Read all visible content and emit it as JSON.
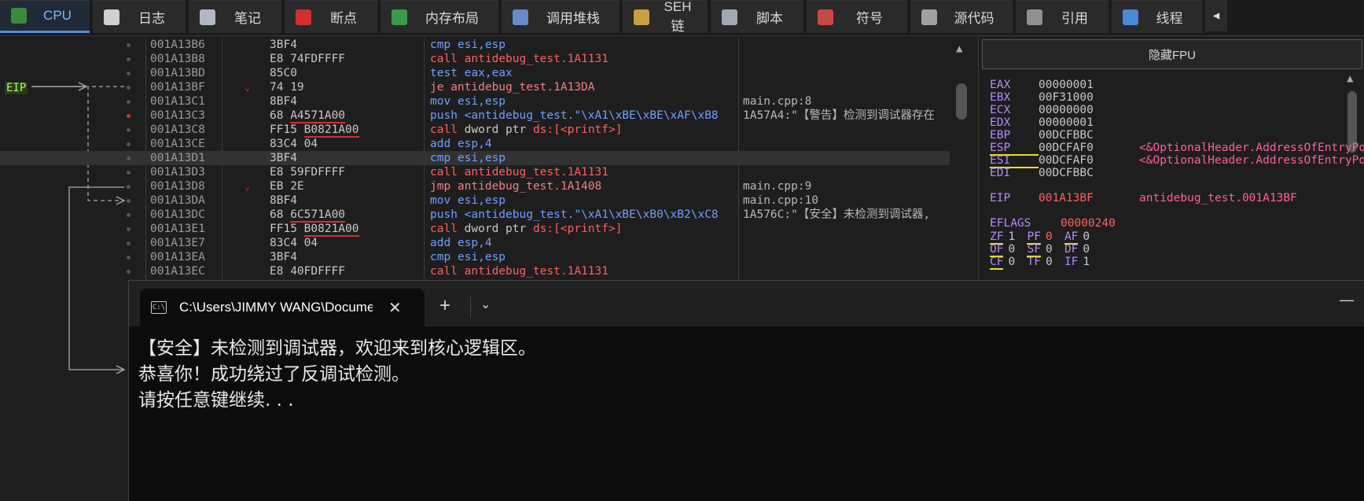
{
  "tabs": [
    {
      "label": "CPU",
      "icon": "cpu-icon",
      "color": "#3a8a3a",
      "active": true
    },
    {
      "label": "日志",
      "icon": "log-icon",
      "color": "#d0d0d0",
      "active": false
    },
    {
      "label": "笔记",
      "icon": "notes-icon",
      "color": "#b0b8c8",
      "active": false
    },
    {
      "label": "断点",
      "icon": "breakpoint-icon",
      "color": "#d03030",
      "active": false
    },
    {
      "label": "内存布局",
      "icon": "memory-map-icon",
      "color": "#3a9a4a",
      "active": false
    },
    {
      "label": "调用堆栈",
      "icon": "call-stack-icon",
      "color": "#6a8ac8",
      "active": false
    },
    {
      "label": "SEH链",
      "icon": "seh-chain-icon",
      "color": "#c8a040",
      "active": false
    },
    {
      "label": "脚本",
      "icon": "script-icon",
      "color": "#a0a8b8",
      "active": false
    },
    {
      "label": "符号",
      "icon": "symbols-icon",
      "color": "#c84848",
      "active": false
    },
    {
      "label": "源代码",
      "icon": "source-code-icon",
      "color": "#a0a0a0",
      "active": false
    },
    {
      "label": "引用",
      "icon": "references-icon",
      "color": "#909090",
      "active": false
    },
    {
      "label": "线程",
      "icon": "threads-icon",
      "color": "#4a8ad8",
      "active": false
    }
  ],
  "disasm": {
    "eip_label": "EIP",
    "rows": [
      {
        "addr": "001A13B6",
        "bytes": "3BF4",
        "ins": [
          [
            "cmp esi,esp",
            "k-blue"
          ]
        ],
        "cmt": ""
      },
      {
        "addr": "001A13B8",
        "bytes": "E8 74FDFFFF",
        "ins": [
          [
            "call antidebug_test.1A1131",
            "k-call"
          ]
        ],
        "cmt": ""
      },
      {
        "addr": "001A13BD",
        "bytes": "85C0",
        "ins": [
          [
            "test eax,eax",
            "k-blue"
          ]
        ],
        "cmt": ""
      },
      {
        "addr": "001A13BF",
        "bytes": "74 19",
        "mark": "⌄",
        "ins": [
          [
            "je antidebug_test.1A13DA",
            "k-jmp"
          ]
        ],
        "cmt": ""
      },
      {
        "addr": "001A13C1",
        "bytes": "8BF4",
        "ins": [
          [
            "mov esi,esp",
            "k-blue"
          ]
        ],
        "cmt": "main.cpp:8"
      },
      {
        "addr": "001A13C3",
        "bytes": "68 ",
        "bytes_ul": "A4571A00",
        "bp": true,
        "ins": [
          [
            "push <antidebug_test.\"\\xA1\\xBE\\xBE\\xAF\\xB8",
            "k-blue"
          ]
        ],
        "cmt": "1A57A4:\"【警告】检测到调试器存在"
      },
      {
        "addr": "001A13C8",
        "bytes": "FF15 ",
        "bytes_ul": "B0821A00",
        "ins": [
          [
            "call ",
            "k-call"
          ],
          [
            "dword ptr ",
            "k-plain"
          ],
          [
            "ds:",
            "k-red"
          ],
          [
            "[<printf>]",
            "k-call"
          ]
        ],
        "cmt": ""
      },
      {
        "addr": "001A13CE",
        "bytes": "83C4 04",
        "ins": [
          [
            "add esp,4",
            "k-blue"
          ]
        ],
        "cmt": ""
      },
      {
        "addr": "001A13D1",
        "bytes": "3BF4",
        "sel": true,
        "ins": [
          [
            "cmp esi,esp",
            "k-blue"
          ]
        ],
        "cmt": ""
      },
      {
        "addr": "001A13D3",
        "bytes": "E8 59FDFFFF",
        "ins": [
          [
            "call antidebug_test.1A1131",
            "k-call"
          ]
        ],
        "cmt": ""
      },
      {
        "addr": "001A13D8",
        "bytes": "EB 2E",
        "mark": "⌄",
        "ins": [
          [
            "jmp antidebug_test.1A1408",
            "k-jmp"
          ]
        ],
        "cmt": "main.cpp:9"
      },
      {
        "addr": "001A13DA",
        "bytes": "8BF4",
        "ins": [
          [
            "mov esi,esp",
            "k-blue"
          ]
        ],
        "cmt": "main.cpp:10"
      },
      {
        "addr": "001A13DC",
        "bytes": "68 ",
        "bytes_ul": "6C571A00",
        "ins": [
          [
            "push <antidebug_test.\"\\xA1\\xBE\\xB0\\xB2\\xC8",
            "k-blue"
          ]
        ],
        "cmt": "1A576C:\"【安全】未检测到调试器,"
      },
      {
        "addr": "001A13E1",
        "bytes": "FF15 ",
        "bytes_ul": "B0821A00",
        "ins": [
          [
            "call ",
            "k-call"
          ],
          [
            "dword ptr ",
            "k-plain"
          ],
          [
            "ds:",
            "k-red"
          ],
          [
            "[<printf>]",
            "k-call"
          ]
        ],
        "cmt": ""
      },
      {
        "addr": "001A13E7",
        "bytes": "83C4 04",
        "ins": [
          [
            "add esp,4",
            "k-blue"
          ]
        ],
        "cmt": ""
      },
      {
        "addr": "001A13EA",
        "bytes": "3BF4",
        "ins": [
          [
            "cmp esi,esp",
            "k-blue"
          ]
        ],
        "cmt": ""
      },
      {
        "addr": "001A13EC",
        "bytes": "E8 40FDFFFF",
        "ins": [
          [
            "call antidebug_test.1A1131",
            "k-call"
          ]
        ],
        "cmt": ""
      }
    ]
  },
  "registers": {
    "fpu_button": "隐藏FPU",
    "gp": [
      {
        "name": "EAX",
        "value": "00000001",
        "comment": ""
      },
      {
        "name": "EBX",
        "value": "00F31000",
        "comment": ""
      },
      {
        "name": "ECX",
        "value": "00000000",
        "comment": ""
      },
      {
        "name": "EDX",
        "value": "00000001",
        "comment": ""
      },
      {
        "name": "EBP",
        "value": "00DCFBBC",
        "comment": ""
      },
      {
        "name": "ESP",
        "value": "00DCFAF0",
        "comment": "<&OptionalHeader.AddressOfEntryPoint>"
      },
      {
        "name": "ESI",
        "value": "00DCFAF0",
        "comment": "<&OptionalHeader.AddressOfEntryPoint>"
      },
      {
        "name": "EDI",
        "value": "00DCFBBC",
        "comment": ""
      }
    ],
    "eip": {
      "name": "EIP",
      "value": "001A13BF",
      "comment": "antidebug_test.001A13BF"
    },
    "eflags": {
      "name": "EFLAGS",
      "value": "00000240"
    },
    "flags_rows": [
      [
        {
          "n": "ZF",
          "v": "1",
          "ul": true,
          "vred": false
        },
        {
          "n": "PF",
          "v": "0",
          "ul": true,
          "vred": true
        },
        {
          "n": "AF",
          "v": "0",
          "ul": true,
          "vred": false
        }
      ],
      [
        {
          "n": "OF",
          "v": "0",
          "ul": true,
          "vred": false
        },
        {
          "n": "SF",
          "v": "0",
          "ul": true,
          "vred": false
        },
        {
          "n": "DF",
          "v": "0",
          "ul": false,
          "vred": false
        }
      ],
      [
        {
          "n": "CF",
          "v": "0",
          "ul": true,
          "vred": false
        },
        {
          "n": "TF",
          "v": "0",
          "ul": false,
          "vred": false
        },
        {
          "n": "IF",
          "v": "1",
          "ul": false,
          "vred": false
        }
      ]
    ]
  },
  "terminal": {
    "tab_title": "C:\\Users\\JIMMY WANG\\Documents",
    "tab_icon_text": "C:\\",
    "new_tab": "+",
    "dropdown": "⌄",
    "close": "✕",
    "minimize": "—",
    "lines": [
      "【安全】未检测到调试器，欢迎来到核心逻辑区。",
      "恭喜你！成功绕过了反调试检测。",
      "请按任意键继续. . ."
    ]
  }
}
